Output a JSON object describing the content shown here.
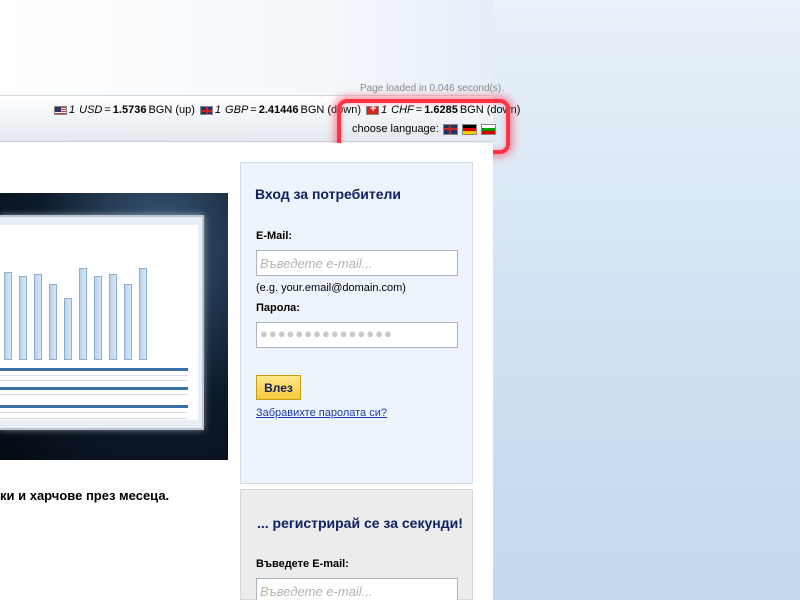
{
  "header": {
    "page_loaded": "Page loaded in 0.046 second(s).",
    "rates": [
      {
        "flag": "us-flag",
        "prefix": "1",
        "currency": "USD",
        "eq": "=",
        "value": "1.5736",
        "unit": "BGN",
        "trend": "(up)"
      },
      {
        "flag": "uk-flag",
        "prefix": "1",
        "currency": "GBP",
        "eq": "=",
        "value": "2.41446",
        "unit": "BGN",
        "trend": "(down)"
      },
      {
        "flag": "swiss-flag",
        "prefix": "1",
        "currency": "CHF",
        "eq": "=",
        "value": "1.6285",
        "unit": "BGN",
        "trend": "(down)"
      }
    ],
    "choose_language": "choose language:",
    "languages": [
      "english-flag-icon",
      "german-flag-icon",
      "bulgarian-flag-icon"
    ],
    "highlight_color": "#ff3344"
  },
  "main": {
    "description": "ки и харчове през месеца."
  },
  "login": {
    "title": "Вход за потребители",
    "email_label": "E-Mail:",
    "email_placeholder": "Въведете e-mail...",
    "email_hint": "(e.g. your.email@domain.com)",
    "password_label": "Парола:",
    "password_value": "●●●●●●●●●●●●●●●",
    "submit_label": "Влез",
    "forgot_label": "Забравихте паролата си?"
  },
  "register": {
    "title": "... регистрирай се за секунди!",
    "email_label": "Въведете E-mail:",
    "email_placeholder": "Въведете e-mail..."
  },
  "colors": {
    "title_blue": "#102060",
    "button_yellow": "#f7c83a",
    "link_blue": "#1a3ab0"
  }
}
